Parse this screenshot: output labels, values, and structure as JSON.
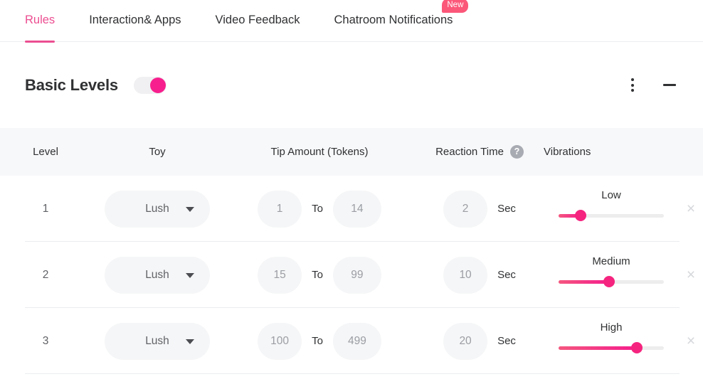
{
  "tabs": [
    {
      "label": "Rules",
      "active": true,
      "badge": null
    },
    {
      "label": "Interaction& Apps",
      "active": false,
      "badge": null
    },
    {
      "label": "Video Feedback",
      "active": false,
      "badge": null
    },
    {
      "label": "Chatroom Notifications",
      "active": false,
      "badge": "New"
    }
  ],
  "section": {
    "title": "Basic Levels",
    "toggle_on": true,
    "menu_icon": "more-vertical-icon",
    "collapse_icon": "minus-icon"
  },
  "table": {
    "columns": [
      {
        "label": "Level"
      },
      {
        "label": "Toy"
      },
      {
        "label": "Tip Amount (Tokens)"
      },
      {
        "label": "Reaction Time",
        "help": "?"
      },
      {
        "label": "Vibrations"
      }
    ],
    "to_label": "To",
    "sec_label": "Sec",
    "delete_label": "×",
    "rows": [
      {
        "level": "1",
        "toy": "Lush",
        "tip_min": "1",
        "tip_max": "14",
        "reaction_time": "2",
        "vibration_label": "Low",
        "vibration_percent": 21
      },
      {
        "level": "2",
        "toy": "Lush",
        "tip_min": "15",
        "tip_max": "99",
        "reaction_time": "10",
        "vibration_label": "Medium",
        "vibration_percent": 48
      },
      {
        "level": "3",
        "toy": "Lush",
        "tip_min": "100",
        "tip_max": "499",
        "reaction_time": "20",
        "vibration_label": "High",
        "vibration_percent": 74
      }
    ]
  },
  "colors": {
    "accent": "#ec4e91",
    "toggle_on": "#f71f8d",
    "badge": "#fb5779",
    "slider_fill": "#f51d8c",
    "header_bg": "#f7f8fa",
    "field_bg": "#f5f6f7"
  }
}
